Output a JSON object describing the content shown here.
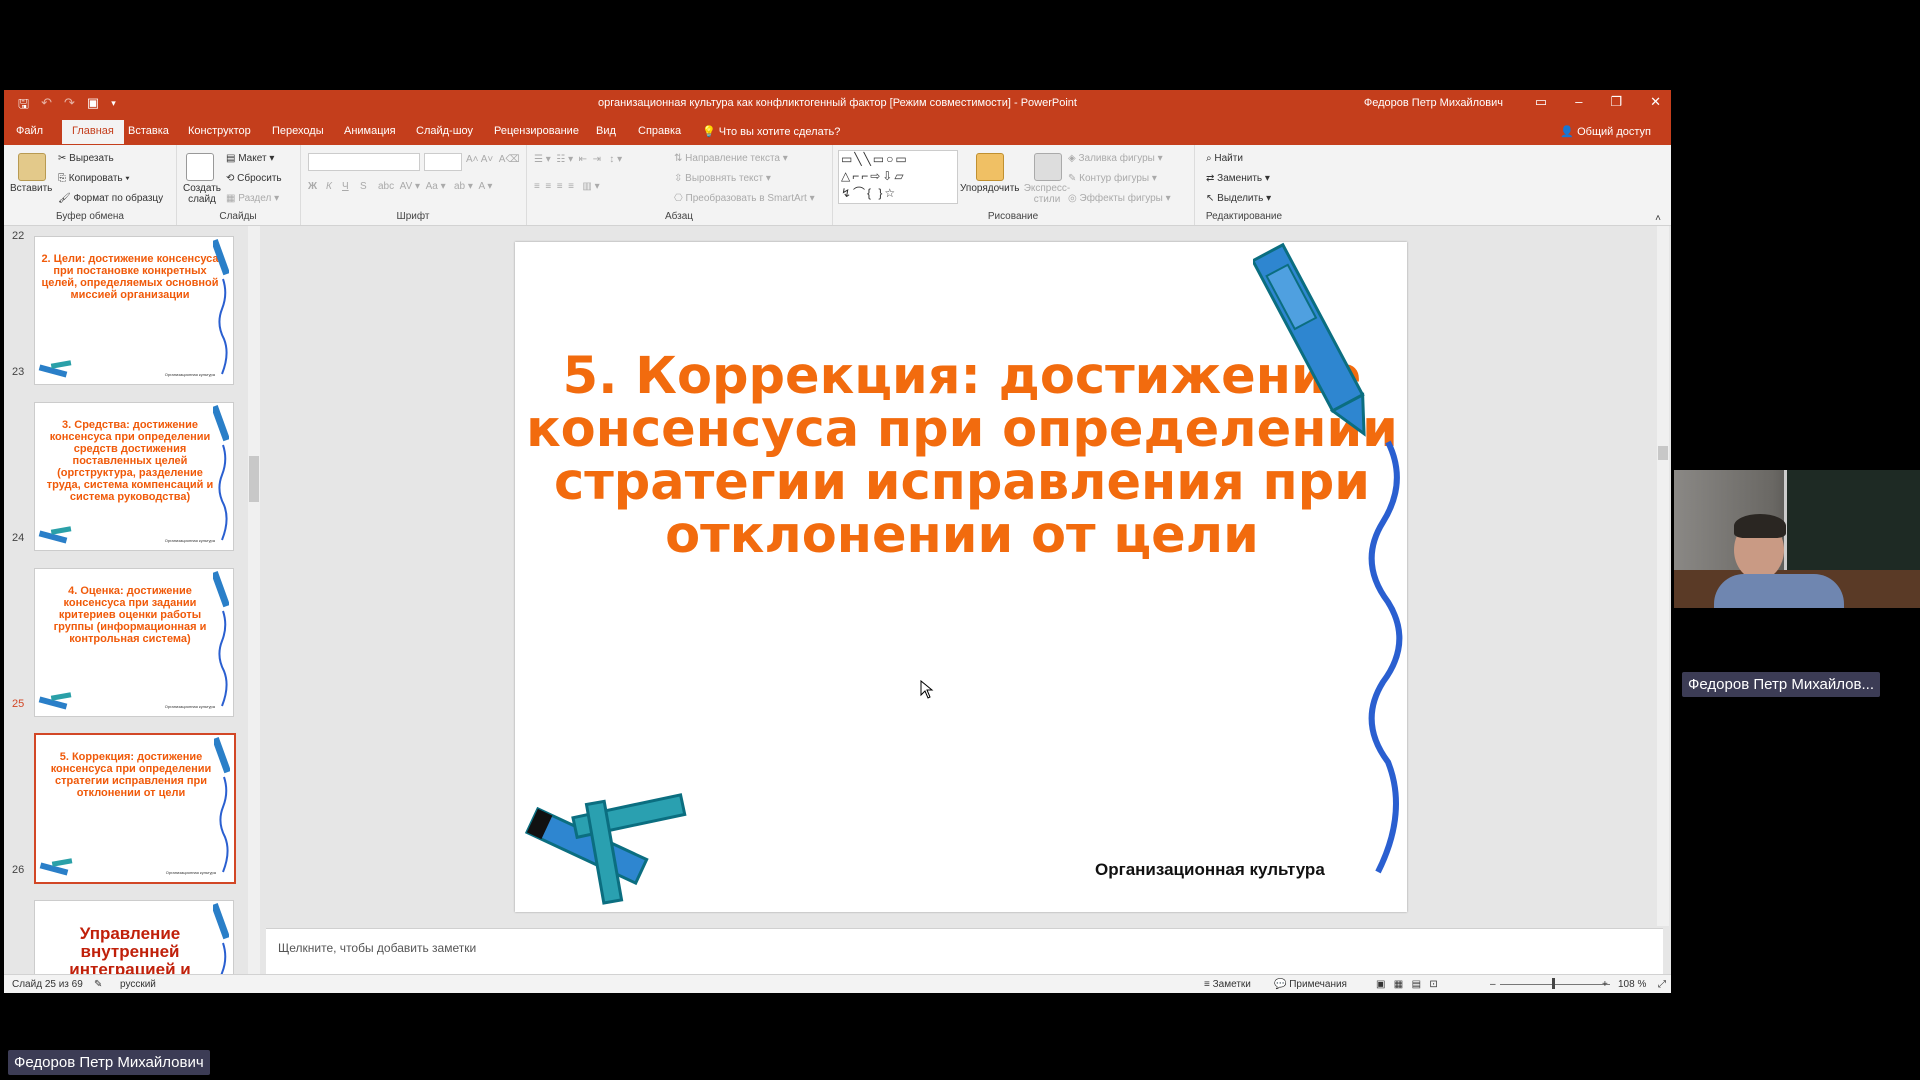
{
  "window": {
    "title": "организационная культура как конфликтогенный фактор [Режим совместимости]  -  PowerPoint",
    "user": "Федоров Петр Михайлович",
    "tabs": [
      "Файл",
      "Главная",
      "Вставка",
      "Конструктор",
      "Переходы",
      "Анимация",
      "Слайд-шоу",
      "Рецензирование",
      "Вид",
      "Справка"
    ],
    "tell_me": "Что вы хотите сделать?",
    "share": "Общий доступ"
  },
  "ribbon": {
    "clipboard": {
      "label": "Буфер обмена",
      "paste": "Вставить",
      "cut": "Вырезать",
      "copy": "Копировать",
      "format_painter": "Формат по образцу"
    },
    "slides": {
      "label": "Слайды",
      "new_slide": "Создать слайд",
      "layout": "Макет",
      "reset": "Сбросить",
      "section": "Раздел"
    },
    "font": {
      "label": "Шрифт",
      "bold": "Ж",
      "italic": "К",
      "underline": "Ч",
      "shadow": "S"
    },
    "paragraph": {
      "label": "Абзац",
      "text_direction": "Направление текста",
      "align_text": "Выровнять текст",
      "smartart": "Преобразовать в SmartArt"
    },
    "drawing": {
      "label": "Рисование",
      "arrange": "Упорядочить",
      "quick_styles": "Экспресс-стили",
      "fill": "Заливка фигуры",
      "outline": "Контур фигуры",
      "effects": "Эффекты фигуры"
    },
    "editing": {
      "label": "Редактирование",
      "find": "Найти",
      "replace": "Заменить",
      "select": "Выделить"
    }
  },
  "thumbnails": [
    {
      "num": "22",
      "title": "2. Цели: достижение консенсуса при постановке конкретных целей, определяемых основной миссией организации",
      "footer": "Организационная культура"
    },
    {
      "num": "23",
      "title": "3. Средства: достижение консенсуса при определении средств достижения поставленных целей (оргструктура, разделение труда, система компенсаций и система руководства)",
      "footer": "Организационная культура"
    },
    {
      "num": "24",
      "title": "4. Оценка: достижение консенсуса при задании критериев оценки работы группы (информационная и контрольная система)",
      "footer": "Организационная культура"
    },
    {
      "num": "25",
      "title": "5. Коррекция: достижение консенсуса при определении стратегии исправления при отклонении от цели",
      "footer": "Организационная культура"
    },
    {
      "num": "26",
      "title": "Управление внутренней интеграцией и",
      "footer": ""
    }
  ],
  "slide": {
    "title": "5. Коррекция: достижение консенсуса при определении стратегии исправления при отклонении от цели",
    "footer": "Организационная культура"
  },
  "notes_placeholder": "Щелкните, чтобы добавить заметки",
  "status": {
    "slide_counter": "Слайд 25 из 69",
    "language": "русский",
    "notes": "Заметки",
    "comments": "Примечания",
    "zoom": "108 %"
  },
  "participants": {
    "video_name": "Федоров Петр Михайлов...",
    "self_name": "Федоров Петр Михайлович"
  },
  "colors": {
    "accent": "#c43e1c",
    "slide_title": "#f26b0e",
    "selection": "#d24726"
  }
}
